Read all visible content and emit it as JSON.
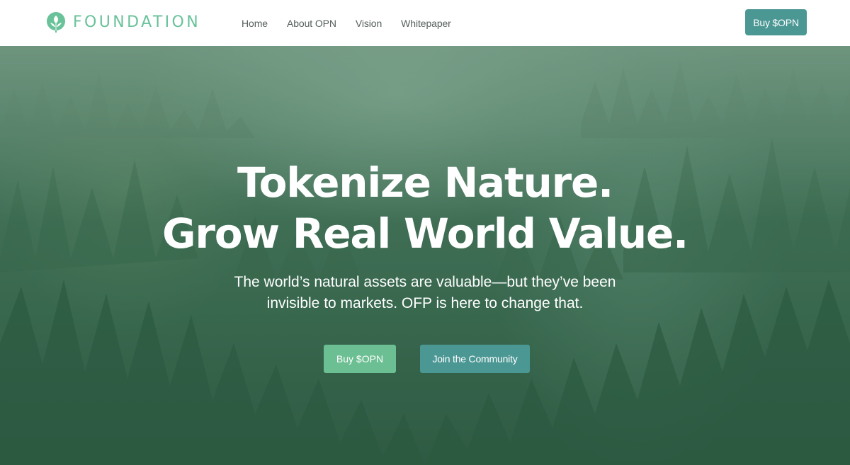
{
  "header": {
    "brand": {
      "name": "FOUNDATION",
      "icon": "leaf-logo-icon",
      "color": "#69c29a"
    },
    "nav": [
      {
        "label": "Home"
      },
      {
        "label": "About OPN"
      },
      {
        "label": "Vision"
      },
      {
        "label": "Whitepaper"
      }
    ],
    "buy_label": "Buy $OPN",
    "buy_color": "#4b9794"
  },
  "hero": {
    "background": "misty-pine-forest-image",
    "headline_line1": "Tokenize Nature.",
    "headline_line2": "Grow Real World Value.",
    "subtitle": "The world’s natural assets are valuable—but they’ve been invisible to markets. OFP is here to change that.",
    "cta_primary": "Buy $OPN",
    "cta_primary_color": "#6cbf92",
    "cta_secondary": "Join the Community",
    "cta_secondary_color": "#4b9794"
  }
}
